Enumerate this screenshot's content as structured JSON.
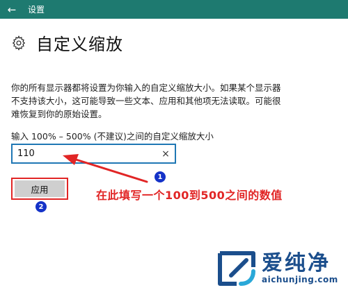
{
  "titlebar": {
    "back_icon": "←",
    "title": "设置"
  },
  "heading": {
    "icon": "gear-icon",
    "title": "自定义缩放"
  },
  "description": "你的所有显示器都将设置为你输入的自定义缩放大小。如果某个显示器不支持该大小，这可能导致一些文本、应用和其他项无法读取。可能很难恢复到你的原始设置。",
  "scale": {
    "label": "输入 100% – 500% (不建议)之间的自定义缩放大小",
    "value": "110",
    "clear_icon": "×"
  },
  "apply_label": "应用",
  "annotation": {
    "badge_1": "1",
    "badge_2": "2",
    "text": "在此填写一个100到500之间的数值"
  },
  "watermark": {
    "cn": "爱纯净",
    "url": "aichunjing.com"
  },
  "colors": {
    "titlebar": "#1e7a70",
    "input_border": "#1f77b4",
    "annotation_red": "#e12525",
    "badge_blue": "#1432c8",
    "watermark_blue": "#1b4e8c"
  }
}
